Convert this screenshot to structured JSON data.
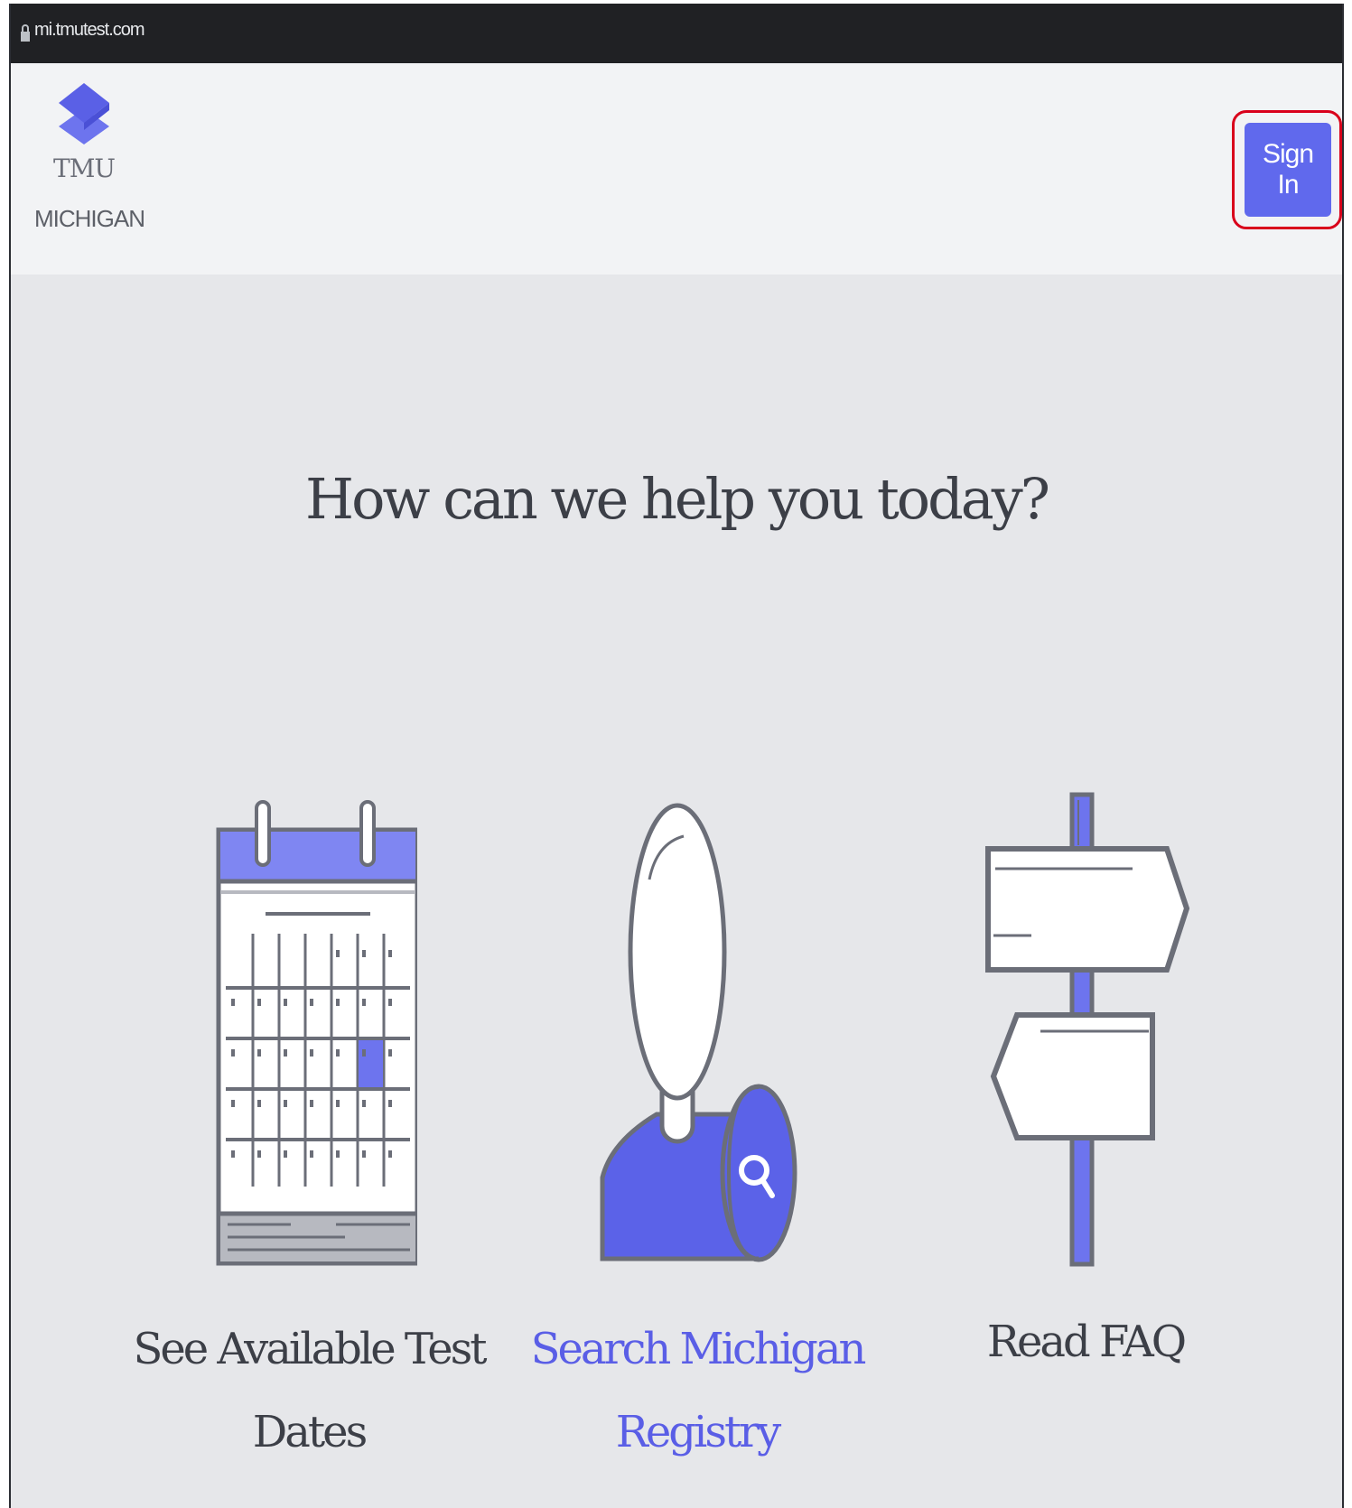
{
  "browser": {
    "url": "mi.tmutest.com"
  },
  "header": {
    "logo_title": "TMU",
    "logo_subtitle": "MICHIGAN",
    "signin_label": "Sign In"
  },
  "main": {
    "headline": "How can we help you today?",
    "options": [
      {
        "label_line1": "See Available Test",
        "label_line2": "Dates",
        "icon": "calendar-icon"
      },
      {
        "label_line1": "Search Michigan",
        "label_line2": "Registry",
        "icon": "person-search-icon"
      },
      {
        "label_line1": "Read FAQ",
        "label_line2": "",
        "icon": "signpost-icon"
      }
    ]
  },
  "colors": {
    "accent": "#6069ed",
    "link": "#5a5ee6",
    "header_bg": "#f2f3f5",
    "page_bg": "#e6e7ea",
    "highlight": "#d9001b"
  }
}
